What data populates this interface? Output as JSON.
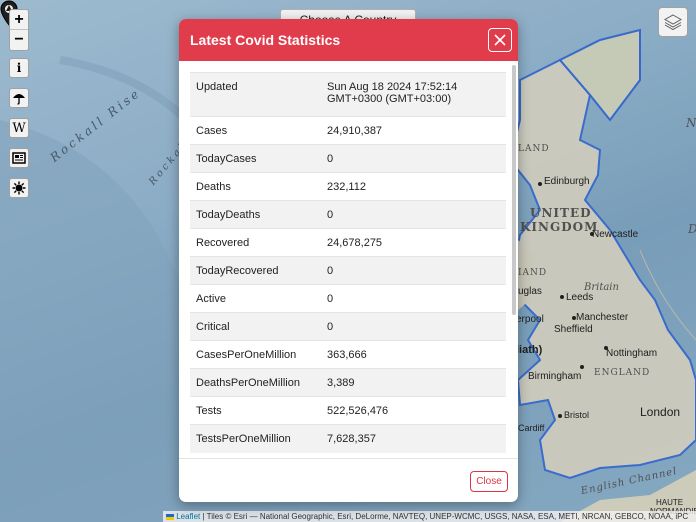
{
  "map": {
    "country_select": "Choose A Country",
    "labels": {
      "rockall_rise": "Rockall Rise",
      "rockall_trough": "Rockall T",
      "uk1": "UNITED",
      "uk2": "KINGDOM",
      "england": "ENGLAND",
      "britain": "Britain",
      "land": "LAND",
      "english_channel": "English Channel",
      "wales": "liath)",
      "haute": "HAUTE",
      "normandie": "NORMANDIE",
      "n_edge": "N",
      "d_edge": "D",
      "ouglas": "uglas",
      "erpool": "erpool",
      "iand": "IAND"
    },
    "cities": {
      "edinburgh": "Edinburgh",
      "newcastle": "Newcastle",
      "leeds": "Leeds",
      "manchester": "Manchester",
      "sheffield": "Sheffield",
      "nottingham": "Nottingham",
      "birmingham": "Birmingham",
      "bristol": "Bristol",
      "cardiff": "Cardiff",
      "london": "London"
    },
    "controls": {
      "zoom_in": "+",
      "zoom_out": "−",
      "info_icon": "info-icon",
      "weather_icon": "umbrella-icon",
      "wiki_icon": "wikipedia-icon",
      "news_icon": "newspaper-icon",
      "covid_icon": "virus-icon",
      "layers_icon": "layers-icon"
    },
    "attribution": {
      "leaflet": "Leaflet",
      "tiles": "| Tiles © Esri — National Geographic, Esri, DeLorme, NAVTEQ, UNEP-WCMC, USGS, NASA, ESA, METI, NRCAN, GEBCO, NOAA, iPC"
    }
  },
  "modal": {
    "title": "Latest Covid Statistics",
    "close_label": "Close",
    "rows": [
      {
        "key": "Updated",
        "value": "Sun Aug 18 2024 17:52:14 GMT+0300 (GMT+03:00)"
      },
      {
        "key": "Cases",
        "value": "24,910,387"
      },
      {
        "key": "TodayCases",
        "value": "0"
      },
      {
        "key": "Deaths",
        "value": "232,112"
      },
      {
        "key": "TodayDeaths",
        "value": "0"
      },
      {
        "key": "Recovered",
        "value": "24,678,275"
      },
      {
        "key": "TodayRecovered",
        "value": "0"
      },
      {
        "key": "Active",
        "value": "0"
      },
      {
        "key": "Critical",
        "value": "0"
      },
      {
        "key": "CasesPerOneMillion",
        "value": "363,666"
      },
      {
        "key": "DeathsPerOneMillion",
        "value": "3,389"
      },
      {
        "key": "Tests",
        "value": "522,526,476"
      },
      {
        "key": "TestsPerOneMillion",
        "value": "7,628,357"
      }
    ]
  },
  "colors": {
    "header": "#e03c4b",
    "close_button": "#dc3545",
    "border_blue": "#3a6fd8"
  }
}
